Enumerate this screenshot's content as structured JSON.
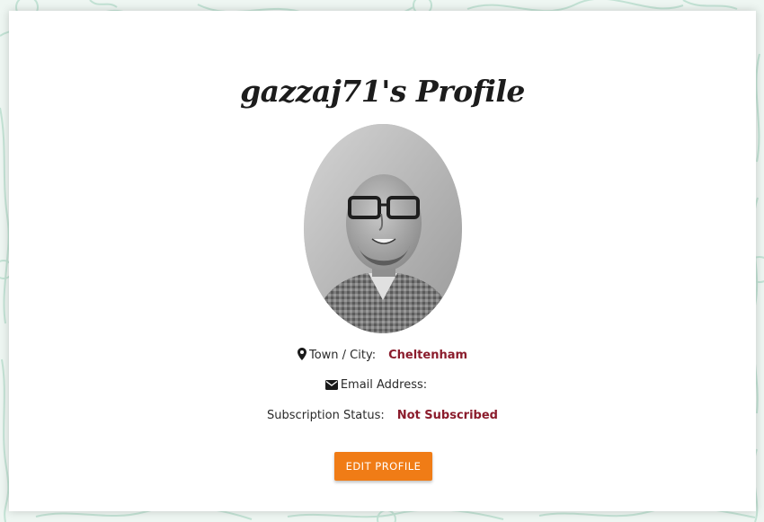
{
  "profile": {
    "title": "gazzaj71's Profile",
    "avatar_alt": "gazzaj71 profile photo"
  },
  "details": {
    "town_label": "Town / City:",
    "town_value": "Cheltenham",
    "email_label": "Email Address:",
    "email_value": "",
    "subscription_label": "Subscription Status:",
    "subscription_value": "Not Subscribed"
  },
  "actions": {
    "edit_label": "EDIT PROFILE"
  },
  "icons": {
    "town": "map-marker-icon",
    "email": "envelope-icon"
  },
  "colors": {
    "accent": "#f07c16",
    "value_text": "#8b1c2c",
    "background_pattern": "#bfe1d2"
  }
}
